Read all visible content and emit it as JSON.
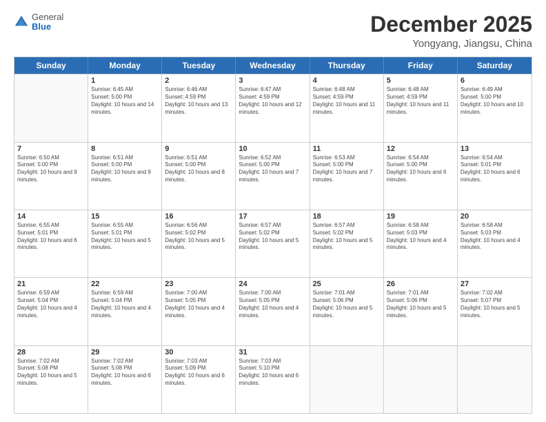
{
  "header": {
    "logo": {
      "general": "General",
      "blue": "Blue"
    },
    "title": "December 2025",
    "location": "Yongyang, Jiangsu, China"
  },
  "weekdays": [
    "Sunday",
    "Monday",
    "Tuesday",
    "Wednesday",
    "Thursday",
    "Friday",
    "Saturday"
  ],
  "rows": [
    [
      {
        "day": "",
        "empty": true
      },
      {
        "day": "1",
        "sunrise": "Sunrise: 6:45 AM",
        "sunset": "Sunset: 5:00 PM",
        "daylight": "Daylight: 10 hours and 14 minutes."
      },
      {
        "day": "2",
        "sunrise": "Sunrise: 6:46 AM",
        "sunset": "Sunset: 4:59 PM",
        "daylight": "Daylight: 10 hours and 13 minutes."
      },
      {
        "day": "3",
        "sunrise": "Sunrise: 6:47 AM",
        "sunset": "Sunset: 4:59 PM",
        "daylight": "Daylight: 10 hours and 12 minutes."
      },
      {
        "day": "4",
        "sunrise": "Sunrise: 6:48 AM",
        "sunset": "Sunset: 4:59 PM",
        "daylight": "Daylight: 10 hours and 11 minutes."
      },
      {
        "day": "5",
        "sunrise": "Sunrise: 6:48 AM",
        "sunset": "Sunset: 4:59 PM",
        "daylight": "Daylight: 10 hours and 11 minutes."
      },
      {
        "day": "6",
        "sunrise": "Sunrise: 6:49 AM",
        "sunset": "Sunset: 5:00 PM",
        "daylight": "Daylight: 10 hours and 10 minutes."
      }
    ],
    [
      {
        "day": "7",
        "sunrise": "Sunrise: 6:50 AM",
        "sunset": "Sunset: 5:00 PM",
        "daylight": "Daylight: 10 hours and 9 minutes."
      },
      {
        "day": "8",
        "sunrise": "Sunrise: 6:51 AM",
        "sunset": "Sunset: 5:00 PM",
        "daylight": "Daylight: 10 hours and 9 minutes."
      },
      {
        "day": "9",
        "sunrise": "Sunrise: 6:51 AM",
        "sunset": "Sunset: 5:00 PM",
        "daylight": "Daylight: 10 hours and 8 minutes."
      },
      {
        "day": "10",
        "sunrise": "Sunrise: 6:52 AM",
        "sunset": "Sunset: 5:00 PM",
        "daylight": "Daylight: 10 hours and 7 minutes."
      },
      {
        "day": "11",
        "sunrise": "Sunrise: 6:53 AM",
        "sunset": "Sunset: 5:00 PM",
        "daylight": "Daylight: 10 hours and 7 minutes."
      },
      {
        "day": "12",
        "sunrise": "Sunrise: 6:54 AM",
        "sunset": "Sunset: 5:00 PM",
        "daylight": "Daylight: 10 hours and 6 minutes."
      },
      {
        "day": "13",
        "sunrise": "Sunrise: 6:54 AM",
        "sunset": "Sunset: 5:01 PM",
        "daylight": "Daylight: 10 hours and 6 minutes."
      }
    ],
    [
      {
        "day": "14",
        "sunrise": "Sunrise: 6:55 AM",
        "sunset": "Sunset: 5:01 PM",
        "daylight": "Daylight: 10 hours and 6 minutes."
      },
      {
        "day": "15",
        "sunrise": "Sunrise: 6:55 AM",
        "sunset": "Sunset: 5:01 PM",
        "daylight": "Daylight: 10 hours and 5 minutes."
      },
      {
        "day": "16",
        "sunrise": "Sunrise: 6:56 AM",
        "sunset": "Sunset: 5:02 PM",
        "daylight": "Daylight: 10 hours and 5 minutes."
      },
      {
        "day": "17",
        "sunrise": "Sunrise: 6:57 AM",
        "sunset": "Sunset: 5:02 PM",
        "daylight": "Daylight: 10 hours and 5 minutes."
      },
      {
        "day": "18",
        "sunrise": "Sunrise: 6:57 AM",
        "sunset": "Sunset: 5:02 PM",
        "daylight": "Daylight: 10 hours and 5 minutes."
      },
      {
        "day": "19",
        "sunrise": "Sunrise: 6:58 AM",
        "sunset": "Sunset: 5:03 PM",
        "daylight": "Daylight: 10 hours and 4 minutes."
      },
      {
        "day": "20",
        "sunrise": "Sunrise: 6:58 AM",
        "sunset": "Sunset: 5:03 PM",
        "daylight": "Daylight: 10 hours and 4 minutes."
      }
    ],
    [
      {
        "day": "21",
        "sunrise": "Sunrise: 6:59 AM",
        "sunset": "Sunset: 5:04 PM",
        "daylight": "Daylight: 10 hours and 4 minutes."
      },
      {
        "day": "22",
        "sunrise": "Sunrise: 6:59 AM",
        "sunset": "Sunset: 5:04 PM",
        "daylight": "Daylight: 10 hours and 4 minutes."
      },
      {
        "day": "23",
        "sunrise": "Sunrise: 7:00 AM",
        "sunset": "Sunset: 5:05 PM",
        "daylight": "Daylight: 10 hours and 4 minutes."
      },
      {
        "day": "24",
        "sunrise": "Sunrise: 7:00 AM",
        "sunset": "Sunset: 5:05 PM",
        "daylight": "Daylight: 10 hours and 4 minutes."
      },
      {
        "day": "25",
        "sunrise": "Sunrise: 7:01 AM",
        "sunset": "Sunset: 5:06 PM",
        "daylight": "Daylight: 10 hours and 5 minutes."
      },
      {
        "day": "26",
        "sunrise": "Sunrise: 7:01 AM",
        "sunset": "Sunset: 5:06 PM",
        "daylight": "Daylight: 10 hours and 5 minutes."
      },
      {
        "day": "27",
        "sunrise": "Sunrise: 7:02 AM",
        "sunset": "Sunset: 5:07 PM",
        "daylight": "Daylight: 10 hours and 5 minutes."
      }
    ],
    [
      {
        "day": "28",
        "sunrise": "Sunrise: 7:02 AM",
        "sunset": "Sunset: 5:08 PM",
        "daylight": "Daylight: 10 hours and 5 minutes."
      },
      {
        "day": "29",
        "sunrise": "Sunrise: 7:02 AM",
        "sunset": "Sunset: 5:08 PM",
        "daylight": "Daylight: 10 hours and 6 minutes."
      },
      {
        "day": "30",
        "sunrise": "Sunrise: 7:03 AM",
        "sunset": "Sunset: 5:09 PM",
        "daylight": "Daylight: 10 hours and 6 minutes."
      },
      {
        "day": "31",
        "sunrise": "Sunrise: 7:03 AM",
        "sunset": "Sunset: 5:10 PM",
        "daylight": "Daylight: 10 hours and 6 minutes."
      },
      {
        "day": "",
        "empty": true
      },
      {
        "day": "",
        "empty": true
      },
      {
        "day": "",
        "empty": true
      }
    ]
  ]
}
